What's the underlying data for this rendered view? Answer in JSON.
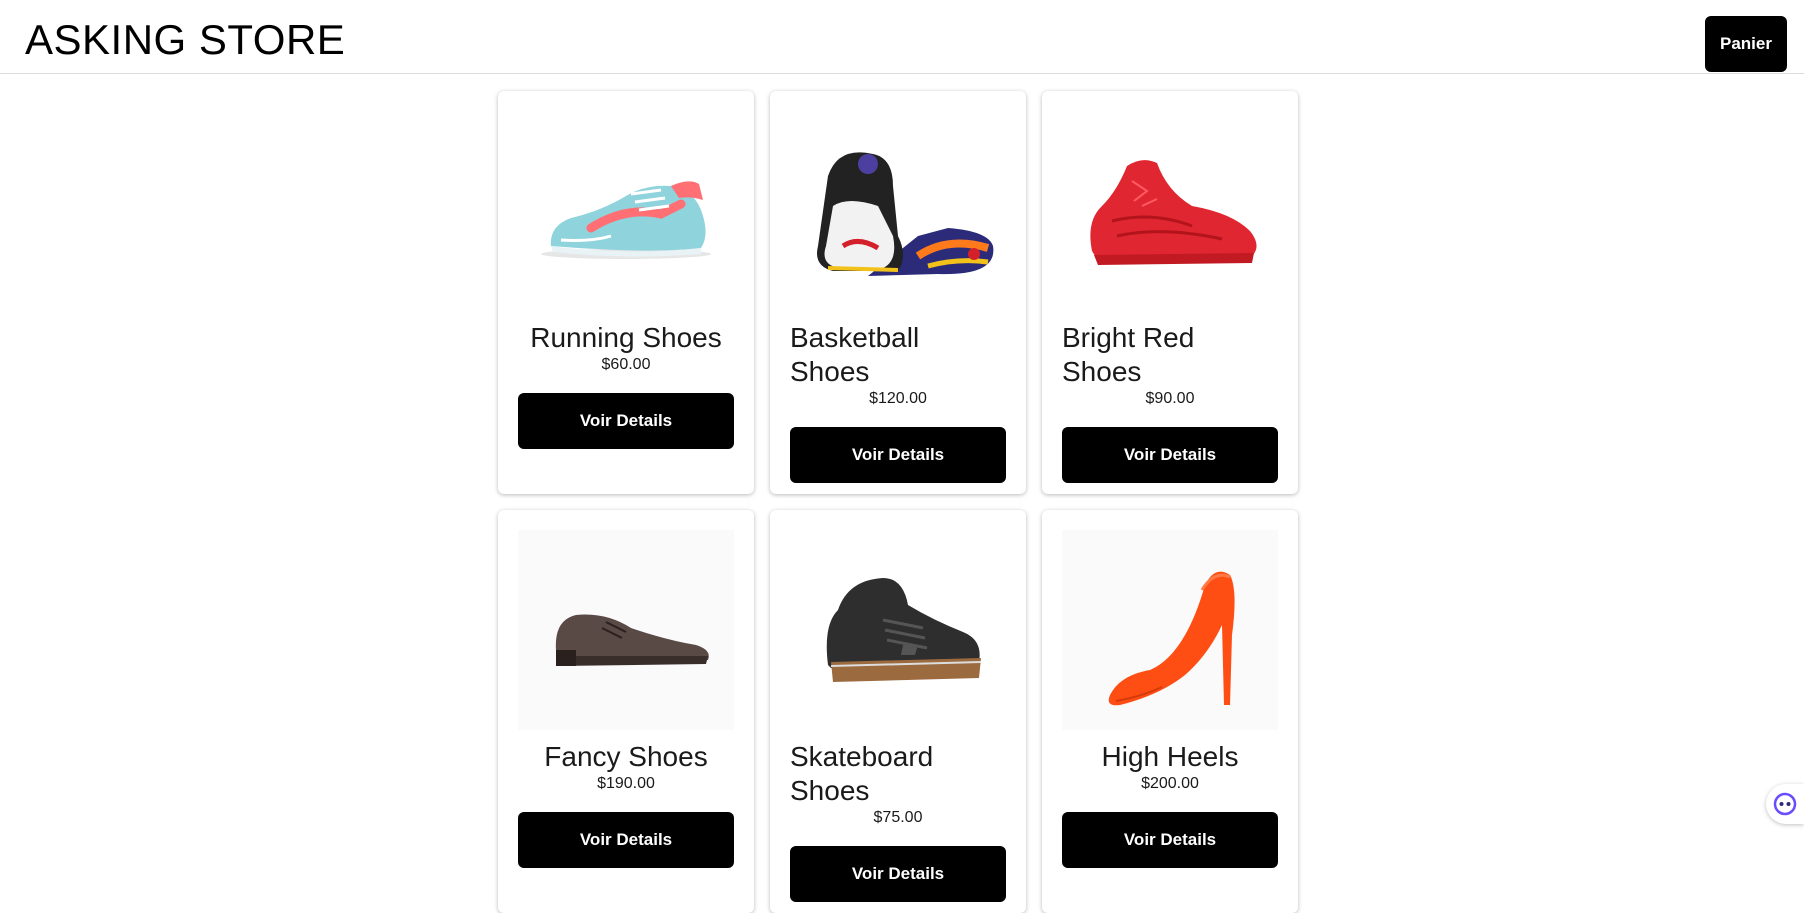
{
  "header": {
    "brand": "ASKING STORE",
    "cart_label": "Panier"
  },
  "products": [
    {
      "name": "Running Shoes",
      "price": "$60.00",
      "button_label": "Voir Details",
      "image_icon": "running-shoe-icon"
    },
    {
      "name": "Basketball Shoes",
      "price": "$120.00",
      "button_label": "Voir Details",
      "image_icon": "basketball-shoe-icon"
    },
    {
      "name": "Bright Red Shoes",
      "price": "$90.00",
      "button_label": "Voir Details",
      "image_icon": "red-shoe-icon"
    },
    {
      "name": "Fancy Shoes",
      "price": "$190.00",
      "button_label": "Voir Details",
      "image_icon": "dress-shoe-icon"
    },
    {
      "name": "Skateboard Shoes",
      "price": "$75.00",
      "button_label": "Voir Details",
      "image_icon": "skate-shoe-icon"
    },
    {
      "name": "High Heels",
      "price": "$200.00",
      "button_label": "Voir Details",
      "image_icon": "high-heel-icon"
    }
  ],
  "colors": {
    "button_bg": "#000000",
    "button_text": "#ffffff",
    "accent_assistant": "#6a4cff"
  }
}
